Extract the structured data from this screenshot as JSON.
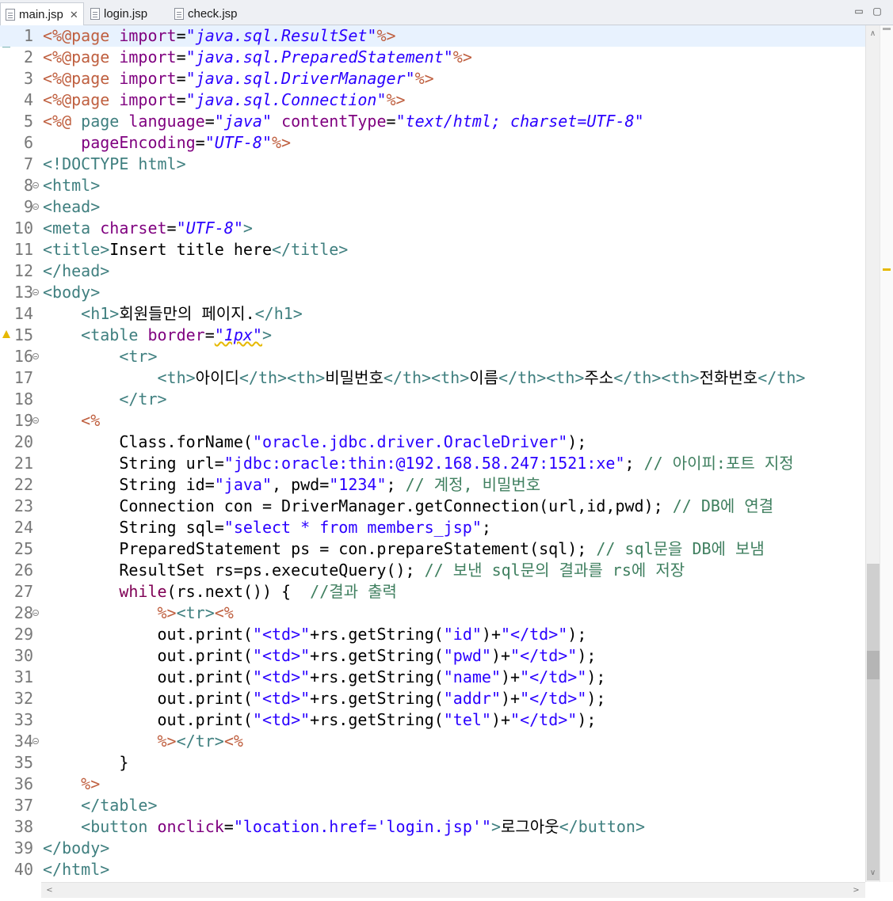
{
  "tabs": [
    {
      "label": "main.jsp",
      "active": true,
      "close": "✕"
    },
    {
      "label": "login.jsp",
      "active": false
    },
    {
      "label": "check.jsp",
      "active": false
    }
  ],
  "window_buttons": {
    "minimize": "▭",
    "maximize": "▢"
  },
  "editor": {
    "current_line": 1,
    "lines": [
      {
        "n": "1",
        "tokens": [
          [
            "jsp",
            "<%@page "
          ],
          [
            "attr",
            "import"
          ],
          [
            "txt",
            "="
          ],
          [
            "val",
            "\"java.sql.ResultSet\""
          ],
          [
            "jsp",
            "%>"
          ]
        ]
      },
      {
        "n": "2",
        "tokens": [
          [
            "jsp",
            "<%@page "
          ],
          [
            "attr",
            "import"
          ],
          [
            "txt",
            "="
          ],
          [
            "val",
            "\"java.sql.PreparedStatement\""
          ],
          [
            "jsp",
            "%>"
          ]
        ]
      },
      {
        "n": "3",
        "tokens": [
          [
            "jsp",
            "<%@page "
          ],
          [
            "attr",
            "import"
          ],
          [
            "txt",
            "="
          ],
          [
            "val",
            "\"java.sql.DriverManager\""
          ],
          [
            "jsp",
            "%>"
          ]
        ]
      },
      {
        "n": "4",
        "tokens": [
          [
            "jsp",
            "<%@page "
          ],
          [
            "attr",
            "import"
          ],
          [
            "txt",
            "="
          ],
          [
            "val",
            "\"java.sql.Connection\""
          ],
          [
            "jsp",
            "%>"
          ]
        ]
      },
      {
        "n": "5",
        "tokens": [
          [
            "jsp",
            "<%@ "
          ],
          [
            "tag",
            "page "
          ],
          [
            "attr",
            "language"
          ],
          [
            "txt",
            "="
          ],
          [
            "val",
            "\"java\" "
          ],
          [
            "attr",
            "contentType"
          ],
          [
            "txt",
            "="
          ],
          [
            "val",
            "\"text/html; charset=UTF-8\""
          ]
        ]
      },
      {
        "n": "6",
        "tokens": [
          [
            "txt",
            "    "
          ],
          [
            "attr",
            "pageEncoding"
          ],
          [
            "txt",
            "="
          ],
          [
            "val",
            "\"UTF-8\""
          ],
          [
            "jsp",
            "%>"
          ]
        ]
      },
      {
        "n": "7",
        "tokens": [
          [
            "tag",
            "<!DOCTYPE html>"
          ]
        ]
      },
      {
        "n": "8",
        "fold": true,
        "tokens": [
          [
            "tag",
            "<html>"
          ]
        ]
      },
      {
        "n": "9",
        "fold": true,
        "tokens": [
          [
            "tag",
            "<head>"
          ]
        ]
      },
      {
        "n": "10",
        "tokens": [
          [
            "tag",
            "<meta "
          ],
          [
            "attr",
            "charset"
          ],
          [
            "txt",
            "="
          ],
          [
            "val",
            "\"UTF-8\""
          ],
          [
            "tag",
            ">"
          ]
        ]
      },
      {
        "n": "11",
        "tokens": [
          [
            "tag",
            "<title>"
          ],
          [
            "txt",
            "Insert title here"
          ],
          [
            "tag",
            "</title>"
          ]
        ]
      },
      {
        "n": "12",
        "tokens": [
          [
            "tag",
            "</head>"
          ]
        ]
      },
      {
        "n": "13",
        "fold": true,
        "tokens": [
          [
            "tag",
            "<body>"
          ]
        ]
      },
      {
        "n": "14",
        "tokens": [
          [
            "txt",
            "    "
          ],
          [
            "tag",
            "<h1>"
          ],
          [
            "txt",
            "회원들만의 페이지."
          ],
          [
            "tag",
            "</h1>"
          ]
        ]
      },
      {
        "n": "15",
        "warn": true,
        "tokens": [
          [
            "txt",
            "    "
          ],
          [
            "tag",
            "<table "
          ],
          [
            "attr",
            "border"
          ],
          [
            "txt",
            "="
          ],
          [
            "valsq",
            "\"1px\""
          ],
          [
            "tag",
            ">"
          ]
        ]
      },
      {
        "n": "16",
        "fold": true,
        "tokens": [
          [
            "txt",
            "        "
          ],
          [
            "tag",
            "<tr>"
          ]
        ]
      },
      {
        "n": "17",
        "tokens": [
          [
            "txt",
            "            "
          ],
          [
            "tag",
            "<th>"
          ],
          [
            "txt",
            "아이디"
          ],
          [
            "tag",
            "</th><th>"
          ],
          [
            "txt",
            "비밀번호"
          ],
          [
            "tag",
            "</th><th>"
          ],
          [
            "txt",
            "이름"
          ],
          [
            "tag",
            "</th><th>"
          ],
          [
            "txt",
            "주소"
          ],
          [
            "tag",
            "</th><th>"
          ],
          [
            "txt",
            "전화번호"
          ],
          [
            "tag",
            "</th>"
          ]
        ]
      },
      {
        "n": "18",
        "tokens": [
          [
            "txt",
            "        "
          ],
          [
            "tag",
            "</tr>"
          ]
        ]
      },
      {
        "n": "19",
        "fold": true,
        "tokens": [
          [
            "txt",
            "    "
          ],
          [
            "jsp",
            "<%"
          ]
        ]
      },
      {
        "n": "20",
        "tokens": [
          [
            "txt",
            "        Class.forName("
          ],
          [
            "str",
            "\"oracle.jdbc.driver.OracleDriver\""
          ],
          [
            "txt",
            ");"
          ]
        ]
      },
      {
        "n": "21",
        "tokens": [
          [
            "txt",
            "        String url="
          ],
          [
            "str",
            "\"jdbc:oracle:thin:@192.168.58.247:1521:xe\""
          ],
          [
            "txt",
            "; "
          ],
          [
            "cmt",
            "// 아이피:포트 지정"
          ]
        ]
      },
      {
        "n": "22",
        "tokens": [
          [
            "txt",
            "        String id="
          ],
          [
            "str",
            "\"java\""
          ],
          [
            "txt",
            ", pwd="
          ],
          [
            "str",
            "\"1234\""
          ],
          [
            "txt",
            "; "
          ],
          [
            "cmt",
            "// 계정, 비밀번호"
          ]
        ]
      },
      {
        "n": "23",
        "tokens": [
          [
            "txt",
            "        Connection con = DriverManager.getConnection(url,id,pwd); "
          ],
          [
            "cmt",
            "// DB에 연결"
          ]
        ]
      },
      {
        "n": "24",
        "tokens": [
          [
            "txt",
            "        String sql="
          ],
          [
            "str",
            "\"select * from members_jsp\""
          ],
          [
            "txt",
            ";"
          ]
        ]
      },
      {
        "n": "25",
        "tokens": [
          [
            "txt",
            "        PreparedStatement ps = con.prepareStatement(sql); "
          ],
          [
            "cmt",
            "// sql문을 DB에 보냄"
          ]
        ]
      },
      {
        "n": "26",
        "tokens": [
          [
            "txt",
            "        ResultSet rs=ps.executeQuery(); "
          ],
          [
            "cmt",
            "// 보낸 sql문의 결과를 rs에 저장"
          ]
        ]
      },
      {
        "n": "27",
        "tokens": [
          [
            "txt",
            "        "
          ],
          [
            "kw",
            "while"
          ],
          [
            "txt",
            "(rs.next()) {  "
          ],
          [
            "cmt",
            "//결과 출력"
          ]
        ]
      },
      {
        "n": "28",
        "fold": true,
        "tokens": [
          [
            "txt",
            "            "
          ],
          [
            "jsp",
            "%>"
          ],
          [
            "tag",
            "<tr>"
          ],
          [
            "jsp",
            "<%"
          ]
        ]
      },
      {
        "n": "29",
        "tokens": [
          [
            "txt",
            "            out.print("
          ],
          [
            "str",
            "\"<td>\""
          ],
          [
            "txt",
            "+rs.getString("
          ],
          [
            "str",
            "\"id\""
          ],
          [
            "txt",
            ")+"
          ],
          [
            "str",
            "\"</td>\""
          ],
          [
            "txt",
            ");"
          ]
        ]
      },
      {
        "n": "30",
        "tokens": [
          [
            "txt",
            "            out.print("
          ],
          [
            "str",
            "\"<td>\""
          ],
          [
            "txt",
            "+rs.getString("
          ],
          [
            "str",
            "\"pwd\""
          ],
          [
            "txt",
            ")+"
          ],
          [
            "str",
            "\"</td>\""
          ],
          [
            "txt",
            ");"
          ]
        ]
      },
      {
        "n": "31",
        "tokens": [
          [
            "txt",
            "            out.print("
          ],
          [
            "str",
            "\"<td>\""
          ],
          [
            "txt",
            "+rs.getString("
          ],
          [
            "str",
            "\"name\""
          ],
          [
            "txt",
            ")+"
          ],
          [
            "str",
            "\"</td>\""
          ],
          [
            "txt",
            ");"
          ]
        ]
      },
      {
        "n": "32",
        "tokens": [
          [
            "txt",
            "            out.print("
          ],
          [
            "str",
            "\"<td>\""
          ],
          [
            "txt",
            "+rs.getString("
          ],
          [
            "str",
            "\"addr\""
          ],
          [
            "txt",
            ")+"
          ],
          [
            "str",
            "\"</td>\""
          ],
          [
            "txt",
            ");"
          ]
        ]
      },
      {
        "n": "33",
        "tokens": [
          [
            "txt",
            "            out.print("
          ],
          [
            "str",
            "\"<td>\""
          ],
          [
            "txt",
            "+rs.getString("
          ],
          [
            "str",
            "\"tel\""
          ],
          [
            "txt",
            ")+"
          ],
          [
            "str",
            "\"</td>\""
          ],
          [
            "txt",
            ");"
          ]
        ]
      },
      {
        "n": "34",
        "fold": true,
        "tokens": [
          [
            "txt",
            "            "
          ],
          [
            "jsp",
            "%>"
          ],
          [
            "tag",
            "</tr>"
          ],
          [
            "jsp",
            "<%"
          ]
        ]
      },
      {
        "n": "35",
        "tokens": [
          [
            "txt",
            "        }"
          ]
        ]
      },
      {
        "n": "36",
        "tokens": [
          [
            "txt",
            "    "
          ],
          [
            "jsp",
            "%>"
          ]
        ]
      },
      {
        "n": "37",
        "tokens": [
          [
            "txt",
            "    "
          ],
          [
            "tag",
            "</table>"
          ]
        ]
      },
      {
        "n": "38",
        "tokens": [
          [
            "txt",
            "    "
          ],
          [
            "tag",
            "<button "
          ],
          [
            "attr",
            "onclick"
          ],
          [
            "txt",
            "="
          ],
          [
            "str",
            "\"location.href='login.jsp'\""
          ],
          [
            "tag",
            ">"
          ],
          [
            "txt",
            "로그아웃"
          ],
          [
            "tag",
            "</button>"
          ]
        ]
      },
      {
        "n": "39",
        "tokens": [
          [
            "tag",
            "</body>"
          ]
        ]
      },
      {
        "n": "40",
        "tokens": [
          [
            "tag",
            "</html>"
          ]
        ]
      }
    ]
  },
  "scrollbar": {
    "up": "∧",
    "down": "∨",
    "left": "<",
    "right": ">"
  },
  "colors": {
    "tag": "#3f7f7f",
    "attr": "#7f007f",
    "value": "#2a00ff",
    "jsp": "#bf5f3f",
    "keyword": "#7f0055",
    "comment": "#3f7f5f",
    "current_line": "#e8f2fe",
    "warning": "#e6b800"
  }
}
